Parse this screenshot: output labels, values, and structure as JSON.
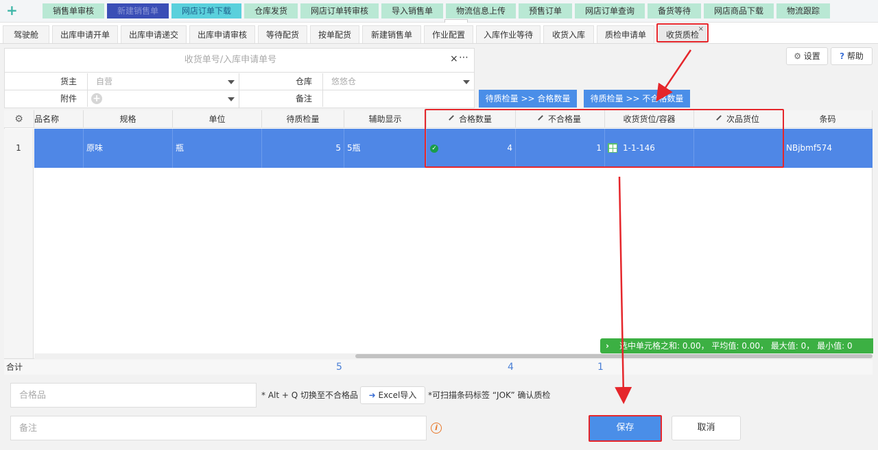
{
  "topbar": {
    "add_icon": "plus-icon",
    "buttons": [
      "销售单审核",
      "新建销售单",
      "网店订单下载",
      "仓库发货",
      "网店订单转审核",
      "导入销售单",
      "物流信息上传",
      "预售订单",
      "网店订单查询",
      "备货等待",
      "网店商品下载",
      "物流跟踪"
    ]
  },
  "tabs": [
    "驾驶舱",
    "出库申请开单",
    "出库申请递交",
    "出库申请审核",
    "等待配货",
    "按单配货",
    "新建销售单",
    "作业配置",
    "入库作业等待",
    "收货入库",
    "质检申请单",
    "收货质检"
  ],
  "form": {
    "search_placeholder": "收货单号/入库申请单号",
    "clear_icon": "×",
    "more_icon": "⋯",
    "owner_label": "货主",
    "owner_value": "自营",
    "warehouse_label": "仓库",
    "warehouse_value": "悠悠仓",
    "attachment_label": "附件",
    "remark_label": "备注"
  },
  "actions": {
    "settings": "设置",
    "help": "帮助",
    "to_qualified": "待质检量 >> 合格数量",
    "to_unqualified": "待质检量 >> 不合格数量"
  },
  "grid": {
    "headers": [
      "品名称",
      "规格",
      "单位",
      "待质检量",
      "辅助显示",
      "合格数量",
      "不合格量",
      "收货货位/容器",
      "次品货位",
      "条码"
    ],
    "row": {
      "num": "1",
      "name": "",
      "spec": "原味",
      "unit": "瓶",
      "pending": "5",
      "aux": "5瓶",
      "qualified": "4",
      "unqualified": "1",
      "location": "1-1-146",
      "defect_location": "",
      "barcode": "NBjbmf574"
    },
    "stats": "选中单元格之和: 0.00， 平均值: 0.00， 最大值: 0， 最小值: 0"
  },
  "totals": {
    "label": "合计",
    "pending": "5",
    "qualified": "4",
    "unqualified": "1"
  },
  "bottom": {
    "qualified_placeholder": "合格品",
    "switch_hint": "* Alt + Q 切换至不合格品",
    "excel_import": "Excel导入",
    "scan_hint": "*可扫描条码标签 “JOK” 确认质检",
    "remark_placeholder": "备注",
    "save": "保存",
    "cancel": "取消"
  },
  "colors": {
    "accent": "#4a8ee8",
    "row_selected": "#4f87e6",
    "annotation": "#e5262b",
    "stats_bar": "#3cb043"
  }
}
